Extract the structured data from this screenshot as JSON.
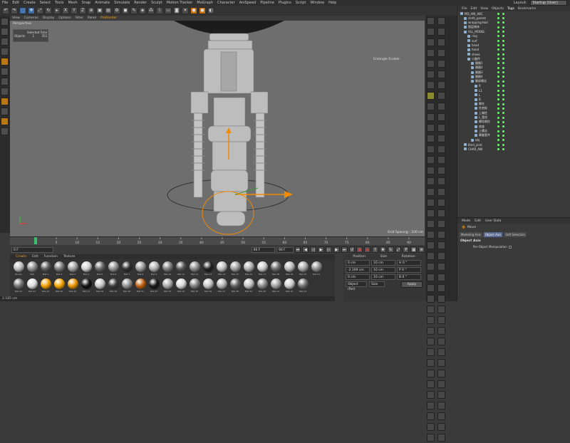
{
  "menubar": {
    "items": [
      "File",
      "Edit",
      "Create",
      "Select",
      "Tools",
      "Mesh",
      "Snap",
      "Animate",
      "Simulate",
      "Render",
      "Sculpt",
      "Motion Tracker",
      "MoGraph",
      "Character",
      "AniSpeed",
      "Pipeline",
      "Plugins",
      "Script",
      "Window",
      "Help"
    ],
    "layout_label": "Layout:",
    "layout_value": "Startup (User)"
  },
  "viewport": {
    "menu": [
      "View",
      "Cameras",
      "Display",
      "Options",
      "Filter",
      "Panel",
      "ProRender"
    ],
    "label": "Perspective",
    "hud": {
      "title": "Selected Total",
      "row_label": "Objects",
      "value1": "1",
      "value2": "352"
    },
    "tooltip": "Entangle Enable",
    "grid_spacing": "Grid Spacing : 100 cm"
  },
  "timeline": {
    "ticks": [
      "0",
      "5",
      "10",
      "15",
      "20",
      "25",
      "30",
      "35",
      "40",
      "45",
      "50",
      "55",
      "60",
      "65",
      "70",
      "75",
      "80",
      "85",
      "90"
    ],
    "current_frame": "0 F",
    "start_field": "0 F",
    "end_field": "90 F",
    "end_field2": "90 F",
    "frame_counter": "0 F"
  },
  "materials": {
    "tabs": [
      "Create",
      "Edit",
      "Function",
      "Texture"
    ],
    "items": [
      {
        "label": "Glossy",
        "color": "#bdbdbd"
      },
      {
        "label": "Mat",
        "color": "#8d8d8d"
      },
      {
        "label": "Mat.1",
        "color": "#5a5a5a"
      },
      {
        "label": "Mat.2",
        "color": "#7a7a7a"
      },
      {
        "label": "Mat.3",
        "color": "#a0a0a0"
      },
      {
        "label": "Mat.4",
        "color": "#d0d0d0"
      },
      {
        "label": "Mat.5",
        "color": "#666666"
      },
      {
        "label": "Mat.6",
        "color": "#909090"
      },
      {
        "label": "Mat.7",
        "color": "#303030"
      },
      {
        "label": "Mat.8",
        "color": "#9a9a9a"
      },
      {
        "label": "Mat.9",
        "color": "#b0b0b0"
      },
      {
        "label": "Mat.10",
        "color": "#7c7c7c"
      },
      {
        "label": "Mat.11",
        "color": "#555555"
      },
      {
        "label": "Mat.12",
        "color": "#8a8a8a"
      },
      {
        "label": "Mat.13",
        "color": "#222222"
      },
      {
        "label": "Mat.14",
        "color": "#bfbfbf"
      },
      {
        "label": "Mat.15",
        "color": "#9c9c9c"
      },
      {
        "label": "Mat.16",
        "color": "#adadad"
      },
      {
        "label": "Mat.17",
        "color": "#cacaca"
      },
      {
        "label": "Mat.18",
        "color": "#6a6a6a"
      },
      {
        "label": "Mat.19",
        "color": "#b8b8b8"
      },
      {
        "label": "Mat.20",
        "color": "#a4a4a4"
      },
      {
        "label": "Mat.21",
        "color": "#8e8e8e"
      },
      {
        "label": "Mat.22",
        "color": "#747474"
      },
      {
        "label": "Mat.23",
        "color": "#dcdcdc"
      },
      {
        "label": "Mat.24",
        "color": "#f0a000"
      },
      {
        "label": "Mat.25",
        "color": "#f5a500"
      },
      {
        "label": "Mat.26",
        "color": "#e89400"
      },
      {
        "label": "Mat.27",
        "color": "#111111"
      },
      {
        "label": "Mat.28",
        "color": "#c8c8c8"
      },
      {
        "label": "Mat.29",
        "color": "#3a3a3a"
      },
      {
        "label": "Mat.30",
        "color": "#909090"
      },
      {
        "label": "Mat.31",
        "color": "#c06010"
      },
      {
        "label": "Mat.32",
        "color": "#181818"
      },
      {
        "label": "Mat.33",
        "color": "#a8a8a8"
      },
      {
        "label": "Mat.34",
        "color": "#d8d8d8"
      },
      {
        "label": "Mat.35",
        "color": "#7e7e7e"
      },
      {
        "label": "Mat.36",
        "color": "#c4c4c4"
      },
      {
        "label": "Mat.37",
        "color": "#b4b4b4"
      },
      {
        "label": "Mat.38",
        "color": "#5e5e5e"
      },
      {
        "label": "Mat.39",
        "color": "#c0c0c0"
      },
      {
        "label": "Mat.40",
        "color": "#8a8a8a"
      },
      {
        "label": "Mat.41",
        "color": "#a0a0a0"
      },
      {
        "label": "Mat.42",
        "color": "#cccccc"
      },
      {
        "label": "Mat.43",
        "color": "#6e6e6e"
      }
    ]
  },
  "coordinates": {
    "headers": [
      "Position",
      "Size",
      "Rotation"
    ],
    "rows": [
      {
        "p": "0 cm",
        "s": "10 cm",
        "r": "H 0 °"
      },
      {
        "p": "-2.169 cm",
        "s": "10 cm",
        "r": "P 0 °"
      },
      {
        "p": "0 cm",
        "s": "10 cm",
        "r": "B 0 °"
      }
    ],
    "mode": "Object (Rel)",
    "size_mode": "Size",
    "apply": "Apply"
  },
  "object_manager": {
    "menu": [
      "File",
      "Edit",
      "View",
      "Objects",
      "Tags",
      "Bookmarks"
    ],
    "items": [
      {
        "name": "MD_ANI_ABC",
        "indent": 0
      },
      {
        "name": "cloth_parent",
        "indent": 1
      },
      {
        "name": "wrapping:Hair",
        "indent": 1
      },
      {
        "name": "图层物体",
        "indent": 1
      },
      {
        "name": "ALL_MODEL",
        "indent": 1
      },
      {
        "name": "ring",
        "indent": 2
      },
      {
        "name": "surf",
        "indent": 2
      },
      {
        "name": "head",
        "indent": 2
      },
      {
        "name": "hand",
        "indent": 2
      },
      {
        "name": "shoes",
        "indent": 2
      },
      {
        "name": "小腿件",
        "indent": 2
      },
      {
        "name": "圈圈1",
        "indent": 3
      },
      {
        "name": "圈圈2",
        "indent": 3
      },
      {
        "name": "圈圈3",
        "indent": 3
      },
      {
        "name": "圈圈4",
        "indent": 3
      },
      {
        "name": "脚部螺丝",
        "indent": 3
      },
      {
        "name": "R",
        "indent": 4
      },
      {
        "name": "L1",
        "indent": 4
      },
      {
        "name": "L",
        "indent": 4
      },
      {
        "name": "B",
        "indent": 4
      },
      {
        "name": "脚柱",
        "indent": 4
      },
      {
        "name": "柱底板",
        "indent": 4
      },
      {
        "name": "上端柱",
        "indent": 4
      },
      {
        "name": "L_管柱",
        "indent": 4
      },
      {
        "name": "螺栓钢柱",
        "indent": 4
      },
      {
        "name": "底座",
        "indent": 4
      },
      {
        "name": "上螺丝",
        "indent": 4
      },
      {
        "name": "脚腿套件",
        "indent": 4
      },
      {
        "name": "obj",
        "indent": 3
      },
      {
        "name": "Bind_joint",
        "indent": 1
      },
      {
        "name": "CHAR_ANI",
        "indent": 1
      }
    ]
  },
  "attribute_manager": {
    "menu": [
      "Mode",
      "Edit",
      "User Data"
    ],
    "title": "Move",
    "tabs": [
      "Modeling Axis",
      "Object Axis",
      "Soft Selection"
    ],
    "section": "Object Axis",
    "option": "Per-Object Manipulation"
  },
  "statusbar": {
    "text": "2.185 cm"
  }
}
